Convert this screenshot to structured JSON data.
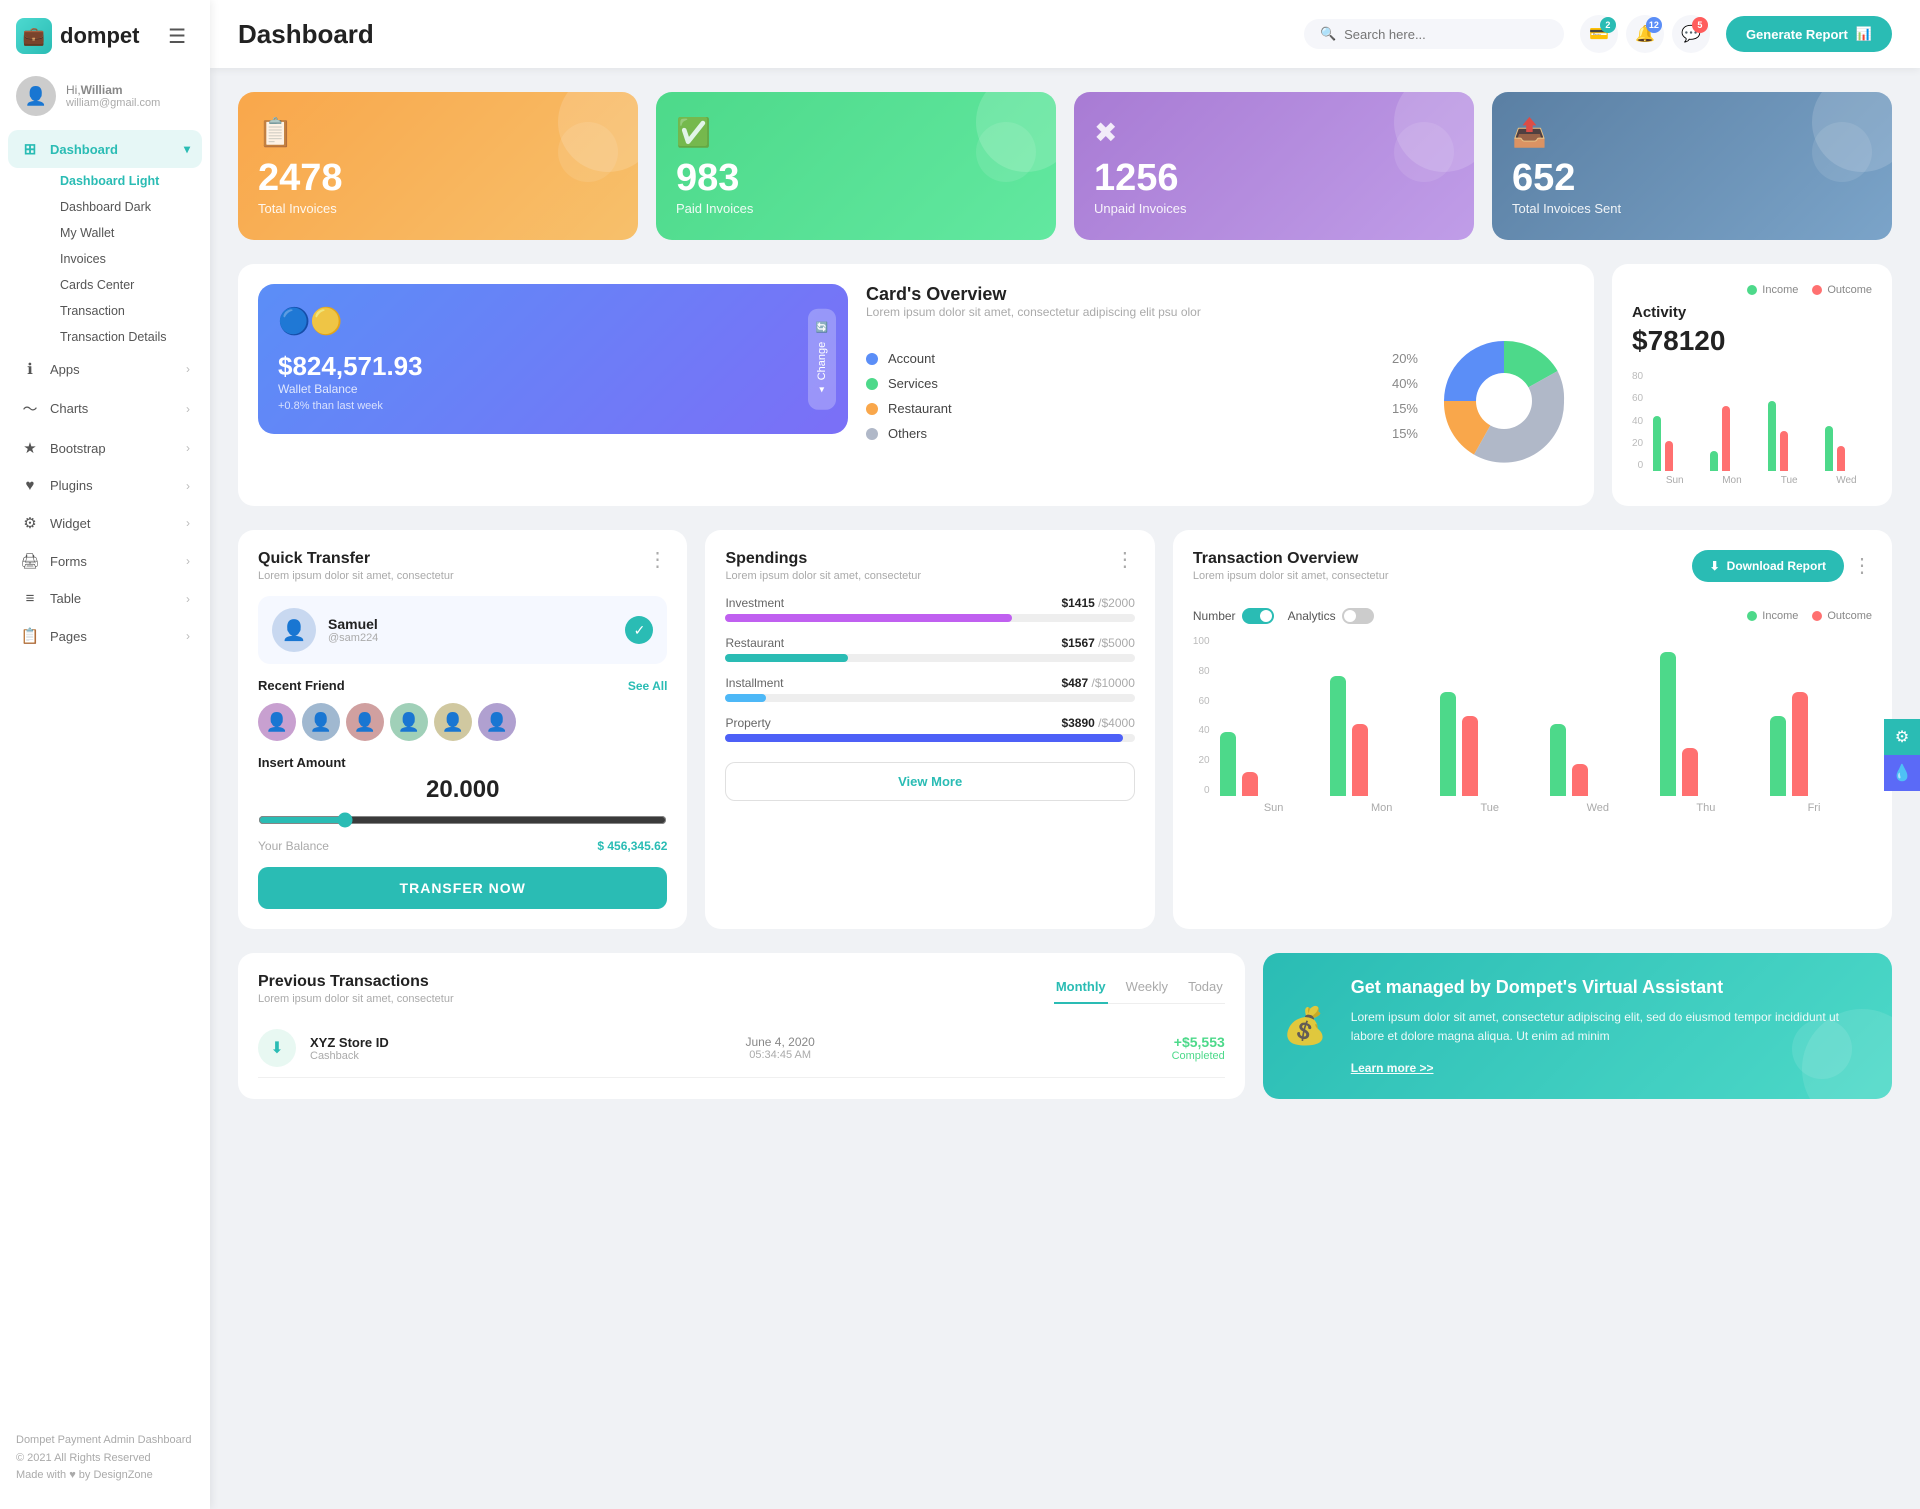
{
  "app": {
    "name": "dompet",
    "logo_icon": "💼"
  },
  "header": {
    "title": "Dashboard",
    "search_placeholder": "Search here...",
    "generate_btn": "Generate Report",
    "notifications": {
      "wallet": 2,
      "bell": 12,
      "msg": 5
    }
  },
  "user": {
    "greeting": "Hi,",
    "name": "William",
    "email": "william@gmail.com"
  },
  "sidebar": {
    "menu_items": [
      {
        "id": "dashboard",
        "label": "Dashboard",
        "icon": "⊞",
        "has_arrow": true,
        "active": true
      },
      {
        "id": "apps",
        "label": "Apps",
        "icon": "ℹ",
        "has_arrow": true
      },
      {
        "id": "charts",
        "label": "Charts",
        "icon": "〜",
        "has_arrow": true
      },
      {
        "id": "bootstrap",
        "label": "Bootstrap",
        "icon": "★",
        "has_arrow": true
      },
      {
        "id": "plugins",
        "label": "Plugins",
        "icon": "♥",
        "has_arrow": true
      },
      {
        "id": "widget",
        "label": "Widget",
        "icon": "⚙",
        "has_arrow": true
      },
      {
        "id": "forms",
        "label": "Forms",
        "icon": "🖨",
        "has_arrow": true
      },
      {
        "id": "table",
        "label": "Table",
        "icon": "≡",
        "has_arrow": true
      },
      {
        "id": "pages",
        "label": "Pages",
        "icon": "📋",
        "has_arrow": true
      }
    ],
    "sub_items": [
      "Dashboard Light",
      "Dashboard Dark",
      "My Wallet",
      "Invoices",
      "Cards Center",
      "Transaction",
      "Transaction Details"
    ],
    "footer_line1": "Dompet Payment Admin Dashboard",
    "footer_line2": "© 2021 All Rights Reserved",
    "footer_line3": "Made with ♥ by DesignZone"
  },
  "stats": [
    {
      "id": "total-invoices",
      "num": "2478",
      "label": "Total Invoices",
      "icon": "📋",
      "color": "orange"
    },
    {
      "id": "paid-invoices",
      "num": "983",
      "label": "Paid Invoices",
      "icon": "✅",
      "color": "green"
    },
    {
      "id": "unpaid-invoices",
      "num": "1256",
      "label": "Unpaid Invoices",
      "icon": "✖",
      "color": "purple"
    },
    {
      "id": "total-sent",
      "num": "652",
      "label": "Total Invoices Sent",
      "icon": "📤",
      "color": "blue-gray"
    }
  ],
  "card_overview": {
    "title": "Card's Overview",
    "subtitle": "Lorem ipsum dolor sit amet, consectetur adipiscing elit psu olor",
    "wallet_amount": "$824,571.93",
    "wallet_label": "Wallet Balance",
    "wallet_change": "+0.8% than last week",
    "change_btn_label": "Change",
    "items": [
      {
        "name": "Account",
        "pct": "20%",
        "color": "#5b8ef7"
      },
      {
        "name": "Services",
        "pct": "40%",
        "color": "#4dd98a"
      },
      {
        "name": "Restaurant",
        "pct": "15%",
        "color": "#f9a74b"
      },
      {
        "name": "Others",
        "pct": "15%",
        "color": "#b0b8c8"
      }
    ]
  },
  "activity": {
    "title": "Activity",
    "amount": "$78120",
    "income_label": "Income",
    "outcome_label": "Outcome",
    "bars": [
      {
        "day": "Sun",
        "income": 55,
        "outcome": 30
      },
      {
        "day": "Mon",
        "income": 20,
        "outcome": 65
      },
      {
        "day": "Tue",
        "income": 70,
        "outcome": 40
      },
      {
        "day": "Wed",
        "income": 45,
        "outcome": 25
      }
    ]
  },
  "quick_transfer": {
    "title": "Quick Transfer",
    "subtitle": "Lorem ipsum dolor sit amet, consectetur",
    "contact_name": "Samuel",
    "contact_handle": "@sam224",
    "recent_friends_label": "Recent Friend",
    "see_all_label": "See All",
    "insert_amount_label": "Insert Amount",
    "amount": "20.000",
    "balance_label": "Your Balance",
    "balance_val": "$ 456,345.62",
    "transfer_btn": "TRANSFER NOW"
  },
  "spendings": {
    "title": "Spendings",
    "subtitle": "Lorem ipsum dolor sit amet, consectetur",
    "items": [
      {
        "name": "Investment",
        "current": "$1415",
        "total": "$2000",
        "pct": 70,
        "color": "#c060f0"
      },
      {
        "name": "Restaurant",
        "current": "$1567",
        "total": "$5000",
        "pct": 30,
        "color": "#2abcb4"
      },
      {
        "name": "Installment",
        "current": "$487",
        "total": "$10000",
        "pct": 10,
        "color": "#4db8f7"
      },
      {
        "name": "Property",
        "current": "$3890",
        "total": "$4000",
        "pct": 97,
        "color": "#4d60f7"
      }
    ],
    "view_more_btn": "View More"
  },
  "transaction_overview": {
    "title": "Transaction Overview",
    "subtitle": "Lorem ipsum dolor sit amet, consectetur",
    "download_btn": "Download Report",
    "toggle_number": "Number",
    "toggle_analytics": "Analytics",
    "income_label": "Income",
    "outcome_label": "Outcome",
    "bars": [
      {
        "day": "Sun",
        "income": 40,
        "outcome": 15
      },
      {
        "day": "Mon",
        "income": 75,
        "outcome": 45
      },
      {
        "day": "Tue",
        "income": 65,
        "outcome": 50
      },
      {
        "day": "Wed",
        "income": 45,
        "outcome": 20
      },
      {
        "day": "Thu",
        "income": 90,
        "outcome": 30
      },
      {
        "day": "Fri",
        "income": 50,
        "outcome": 65
      }
    ],
    "y_labels": [
      "100",
      "80",
      "60",
      "40",
      "20",
      "0"
    ]
  },
  "previous_transactions": {
    "title": "Previous Transactions",
    "subtitle": "Lorem ipsum dolor sit amet, consectetur",
    "tabs": [
      "Monthly",
      "Weekly",
      "Today"
    ],
    "active_tab": "Monthly",
    "items": [
      {
        "icon": "⬇",
        "name": "XYZ Store ID",
        "sub": "Cashback",
        "date": "June 4, 2020",
        "time": "05:34:45 AM",
        "amount": "+$5,553",
        "status": "Completed"
      }
    ]
  },
  "va_promo": {
    "title": "Get managed by Dompet's Virtual Assistant",
    "text": "Lorem ipsum dolor sit amet, consectetur adipiscing elit, sed do eiusmod tempor incididunt ut labore et dolore magna aliqua. Ut enim ad minim",
    "link": "Learn more >>",
    "icon": "💰"
  }
}
